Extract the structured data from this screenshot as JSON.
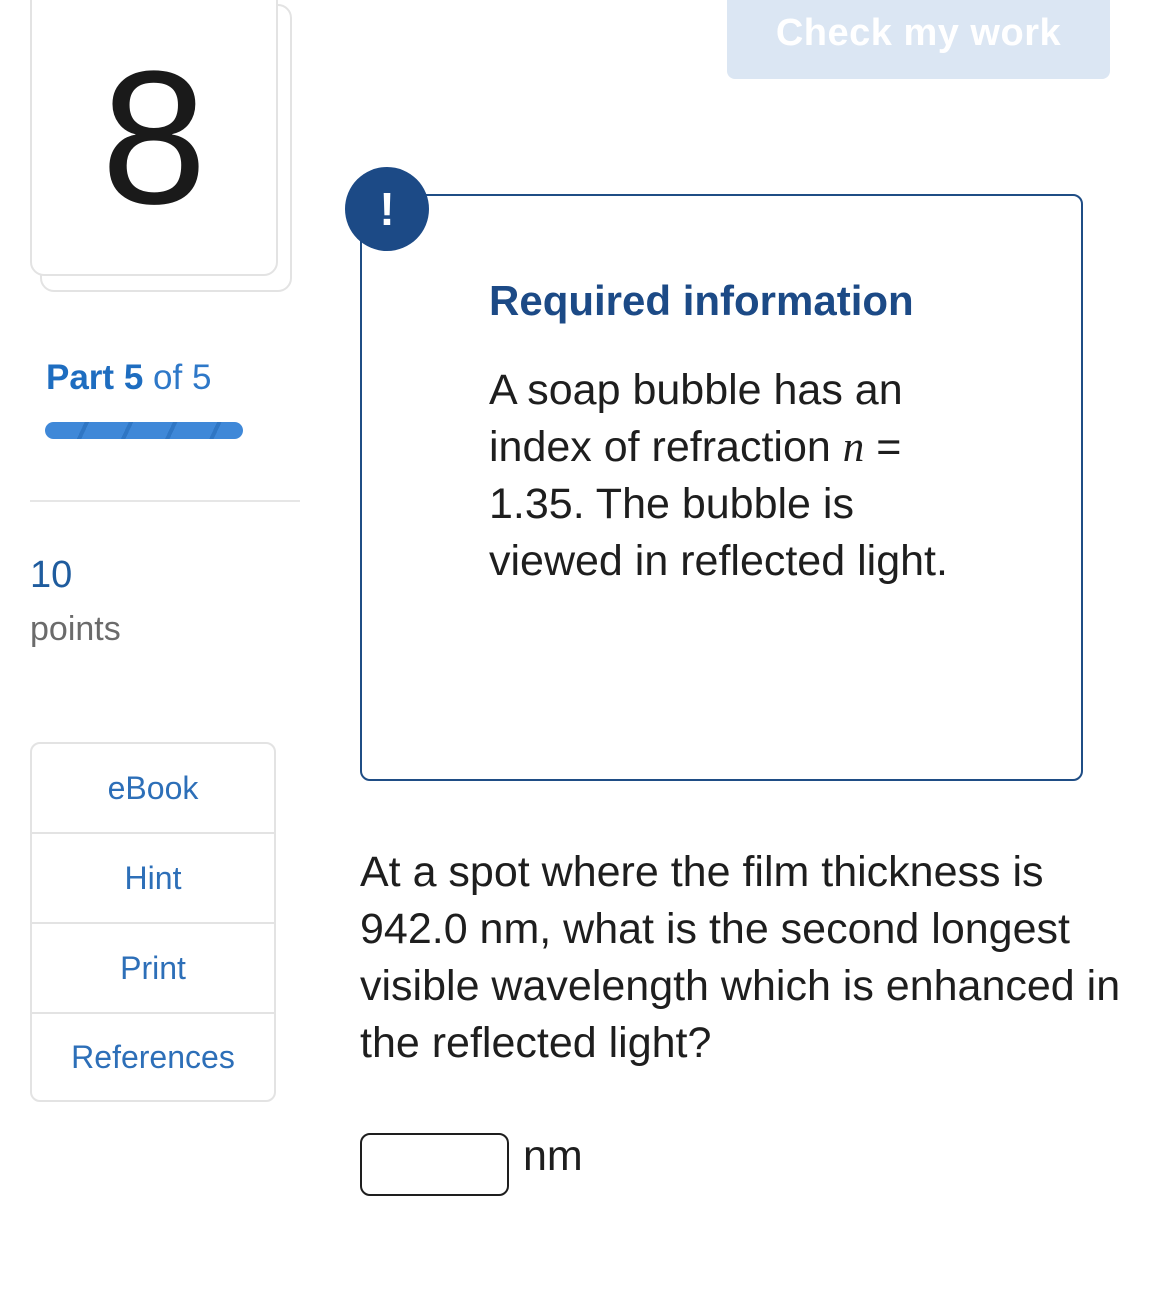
{
  "question": {
    "number": "8",
    "part_word": "Part",
    "part_current": "5",
    "part_of_total": "of 5",
    "progress_fraction": 1.0,
    "points_value": "10",
    "points_label": "points"
  },
  "tools": [
    {
      "label": "eBook"
    },
    {
      "label": "Hint"
    },
    {
      "label": "Print"
    },
    {
      "label": "References"
    }
  ],
  "header": {
    "check_button_label": "Check my work"
  },
  "required_info": {
    "badge_symbol": "!",
    "title": "Required information",
    "text_before_var": "A soap bubble has an index of refraction ",
    "variable": "n",
    "text_after_var": " = 1.35. The bubble is viewed in reflected light."
  },
  "prompt": {
    "text": "At a spot where the film thickness is 942.0 nm, what is the second longest visible wavelength which is enhanced in the reflected light?",
    "answer_value": "",
    "unit": "nm"
  },
  "colors": {
    "accent_blue": "#1c4a86",
    "link_blue": "#2d6fb8",
    "progress_blue": "#3d86d6",
    "disabled_button": "#dbe6f3"
  }
}
